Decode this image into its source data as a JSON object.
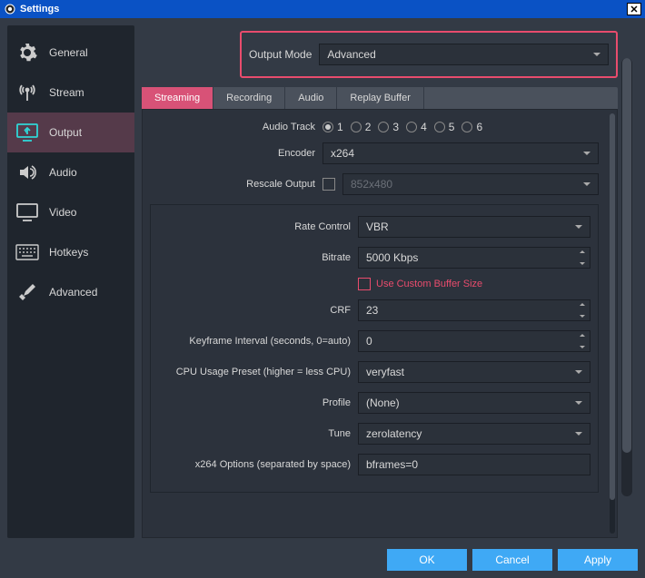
{
  "window": {
    "title": "Settings"
  },
  "sidebar": {
    "items": [
      {
        "label": "General"
      },
      {
        "label": "Stream"
      },
      {
        "label": "Output"
      },
      {
        "label": "Audio"
      },
      {
        "label": "Video"
      },
      {
        "label": "Hotkeys"
      },
      {
        "label": "Advanced"
      }
    ]
  },
  "output_mode": {
    "label": "Output Mode",
    "value": "Advanced"
  },
  "tabs": [
    {
      "label": "Streaming"
    },
    {
      "label": "Recording"
    },
    {
      "label": "Audio"
    },
    {
      "label": "Replay Buffer"
    }
  ],
  "top_form": {
    "audio_track_label": "Audio Track",
    "audio_tracks": [
      "1",
      "2",
      "3",
      "4",
      "5",
      "6"
    ],
    "encoder_label": "Encoder",
    "encoder_value": "x264",
    "rescale_label": "Rescale Output",
    "rescale_value": "852x480"
  },
  "enc": {
    "rate_control_label": "Rate Control",
    "rate_control_value": "VBR",
    "bitrate_label": "Bitrate",
    "bitrate_value": "5000 Kbps",
    "custom_buffer_label": "Use Custom Buffer Size",
    "crf_label": "CRF",
    "crf_value": "23",
    "keyframe_label": "Keyframe Interval (seconds, 0=auto)",
    "keyframe_value": "0",
    "cpu_preset_label": "CPU Usage Preset (higher = less CPU)",
    "cpu_preset_value": "veryfast",
    "profile_label": "Profile",
    "profile_value": "(None)",
    "tune_label": "Tune",
    "tune_value": "zerolatency",
    "x264_opts_label": "x264 Options (separated by space)",
    "x264_opts_value": "bframes=0"
  },
  "footer": {
    "ok": "OK",
    "cancel": "Cancel",
    "apply": "Apply"
  }
}
